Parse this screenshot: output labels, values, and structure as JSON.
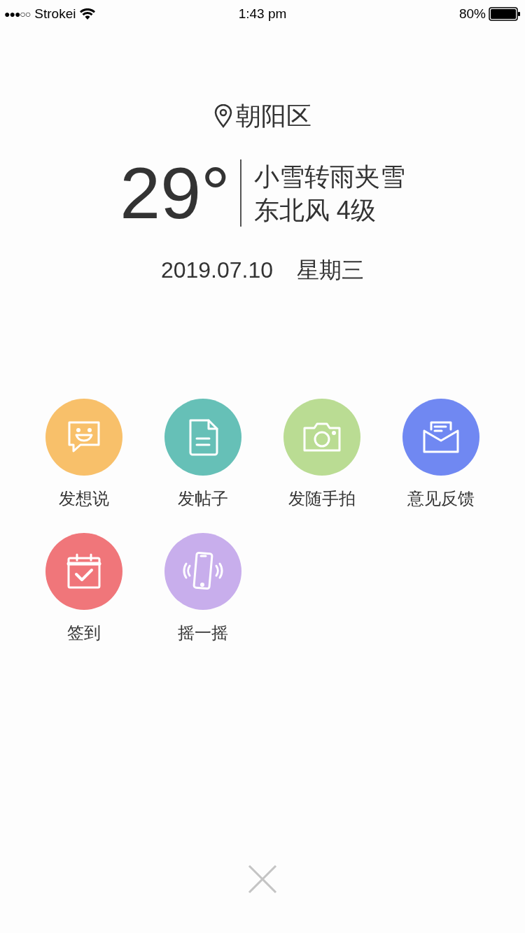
{
  "status_bar": {
    "signal_dots": "●●●○○",
    "carrier": "Strokei",
    "time": "1:43 pm",
    "battery": "80%"
  },
  "weather": {
    "location": "朝阳区",
    "temperature": "29°",
    "condition": "小雪转雨夹雪",
    "wind": "东北风 4级",
    "date": "2019.07.10",
    "weekday": "星期三"
  },
  "actions": [
    {
      "label": "发想说",
      "kind": "chat",
      "color": "#f8c06a"
    },
    {
      "label": "发帖子",
      "kind": "document",
      "color": "#66c0b7"
    },
    {
      "label": "发随手拍",
      "kind": "camera",
      "color": "#badc93"
    },
    {
      "label": "意见反馈",
      "kind": "mail",
      "color": "#7088f2"
    },
    {
      "label": "签到",
      "kind": "calendar",
      "color": "#f0767a"
    },
    {
      "label": "摇一摇",
      "kind": "shake",
      "color": "#c8aeec"
    }
  ]
}
